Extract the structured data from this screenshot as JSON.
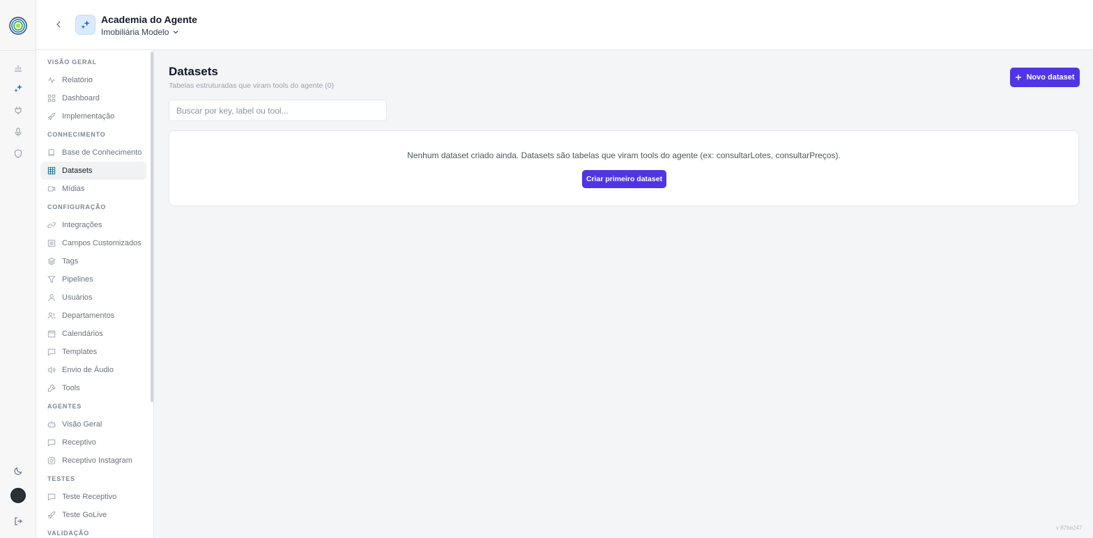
{
  "header": {
    "agent_title": "Academia do Agente",
    "workspace": "Imobiliária Modelo"
  },
  "sidebar": {
    "sections": [
      {
        "title": "VISÃO GERAL",
        "items": [
          {
            "label": "Relatório",
            "icon": "activity-icon"
          },
          {
            "label": "Dashboard",
            "icon": "grid-icon"
          },
          {
            "label": "Implementação",
            "icon": "rocket-icon"
          }
        ]
      },
      {
        "title": "CONHECIMENTO",
        "items": [
          {
            "label": "Base de Conhecimento",
            "icon": "book-icon"
          },
          {
            "label": "Datasets",
            "icon": "table-icon",
            "active": true
          },
          {
            "label": "Mídias",
            "icon": "video-icon"
          }
        ]
      },
      {
        "title": "CONFIGURAÇÃO",
        "items": [
          {
            "label": "Integrações",
            "icon": "link-icon"
          },
          {
            "label": "Campos Customizados",
            "icon": "list-icon"
          },
          {
            "label": "Tags",
            "icon": "layers-icon"
          },
          {
            "label": "Pipelines",
            "icon": "filter-icon"
          },
          {
            "label": "Usuários",
            "icon": "user-icon"
          },
          {
            "label": "Departamentos",
            "icon": "users-icon"
          },
          {
            "label": "Calendários",
            "icon": "calendar-icon"
          },
          {
            "label": "Templates",
            "icon": "message-icon"
          },
          {
            "label": "Envio de Áudio",
            "icon": "volume-icon"
          },
          {
            "label": "Tools",
            "icon": "wrench-icon"
          }
        ]
      },
      {
        "title": "AGENTES",
        "items": [
          {
            "label": "Visão Geral",
            "icon": "bot-icon"
          },
          {
            "label": "Receptivo",
            "icon": "message-icon"
          },
          {
            "label": "Receptivo Instagram",
            "icon": "instagram-icon"
          }
        ]
      },
      {
        "title": "TESTES",
        "items": [
          {
            "label": "Teste Receptivo",
            "icon": "message-icon"
          },
          {
            "label": "Teste GoLive",
            "icon": "rocket-icon"
          }
        ]
      },
      {
        "title": "VALIDAÇÃO",
        "items": []
      }
    ]
  },
  "main": {
    "title": "Datasets",
    "subtitle": "Tabelas estruturadas que viram tools do agente (0)",
    "new_button": "Novo dataset",
    "search_placeholder": "Buscar por key, label ou tool...",
    "empty_text": "Nenhum dataset criado ainda. Datasets são tabelas que viram tools do agente (ex: consultarLotes, consultarPreços).",
    "create_button": "Criar primeiro dataset"
  },
  "version": "v 87be247",
  "colors": {
    "accent": "#4f35e6",
    "active_icon": "#0e7490",
    "rail_active": "#2563eb"
  }
}
